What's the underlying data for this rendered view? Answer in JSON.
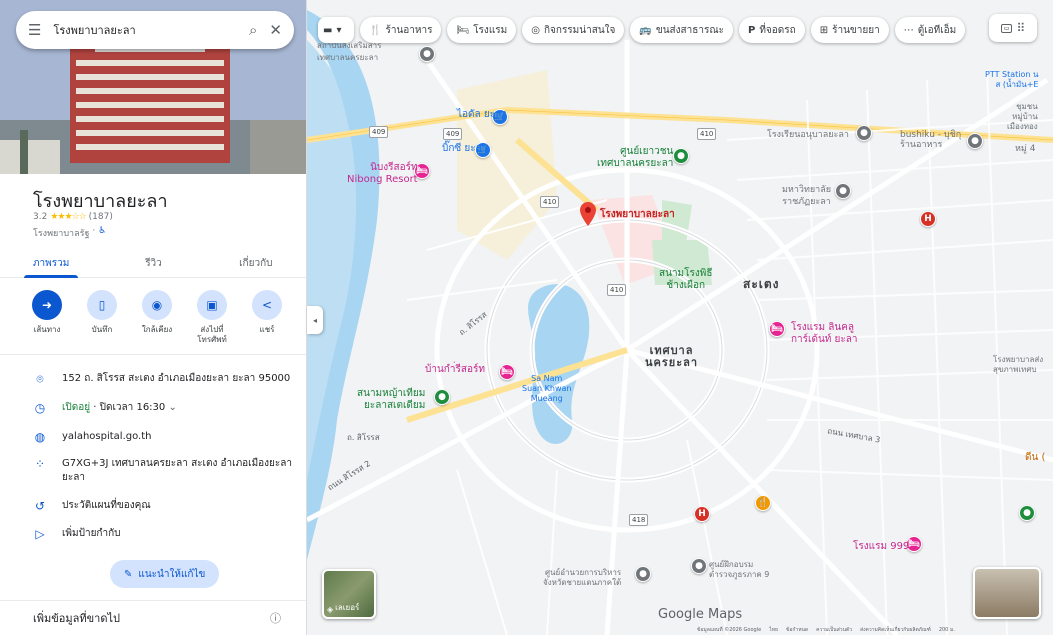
{
  "search": {
    "value": "โรงพยาบาลยะลา"
  },
  "place": {
    "name": "โรงพยาบาลยะลา",
    "rating": "3.2",
    "stars": "★★★☆☆",
    "reviews": "(187)",
    "category": "โรงพยาบาลรัฐ",
    "accessibility_icon": "accessible-icon"
  },
  "tabs": [
    "ภาพรวม",
    "รีวิว",
    "เกี่ยวกับ"
  ],
  "actions": [
    {
      "label": "เส้นทาง",
      "icon": "directions-icon"
    },
    {
      "label": "บันทึก",
      "icon": "bookmark-icon"
    },
    {
      "label": "ใกล้เคียง",
      "icon": "nearby-icon"
    },
    {
      "label": "ส่งไปที่โทรศัพท์",
      "icon": "send-to-phone-icon"
    },
    {
      "label": "แชร์",
      "icon": "share-icon"
    }
  ],
  "info": {
    "address": "152 ถ. สิโรรส สะเตง อำเภอเมืองยะลา ยะลา 95000",
    "hours_open": "เปิดอยู่",
    "hours_close": " · ปิดเวลา 16:30",
    "website": "yalahospital.go.th",
    "plus_code": "G7XG+3J เทศบาลนครยะลา สะเตง อำเภอเมืองยะลา ยะลา",
    "history": "ประวัติแผนที่ของคุณ",
    "label": "เพิ่มป้ายกำกับ"
  },
  "suggest_edit": "แนะนำให้แก้ไข",
  "add_missing": "เพิ่มข้อมูลที่ขาดไป",
  "chips": [
    {
      "icon": "restaurant-icon",
      "glyph": "🍴",
      "label": "ร้านอาหาร"
    },
    {
      "icon": "hotel-icon",
      "glyph": "🛏",
      "label": "โรงแรม"
    },
    {
      "icon": "camera-icon",
      "glyph": "◎",
      "label": "กิจกรรมน่าสนใจ"
    },
    {
      "icon": "transit-icon",
      "glyph": "🚌",
      "label": "ขนส่งสาธารณะ"
    },
    {
      "icon": "parking-icon",
      "glyph": "P",
      "label": "ที่จอดรถ"
    },
    {
      "icon": "pharmacy-icon",
      "glyph": "⊞",
      "label": "ร้านขายยา"
    },
    {
      "icon": "more-icon",
      "glyph": "⋯",
      "label": "ตู้เอทีเอ็ม"
    }
  ],
  "map": {
    "labels": [
      {
        "text": "สถาบันส่งเสริมสาร\nเทศบาลนครยะลา",
        "cls": "gray"
      },
      {
        "text": "ไอดัล ยะลา",
        "cls": "blue"
      },
      {
        "text": "บิ๊กซี ยะลา",
        "cls": "blue"
      },
      {
        "text": "นิบงรีสอร์ท\nNibong Resort",
        "cls": "pink"
      },
      {
        "text": "ศูนย์เยาวชน\nเทศบาลนครยะลา",
        "cls": "green"
      },
      {
        "text": "โรงพยาบาลยะลา",
        "cls": "red"
      },
      {
        "text": "สนามโรงพิธี\nช้างเผือก",
        "cls": "green"
      },
      {
        "text": "สะเตง",
        "cls": "dark"
      },
      {
        "text": "เทศบาล\nนครยะลา",
        "cls": "dark2"
      },
      {
        "text": "โรงแรม ลินคลู\nการ์เด้นท์ ยะลา",
        "cls": "pink"
      },
      {
        "text": "บ้านกำ่รีสอร์ท",
        "cls": "pink"
      },
      {
        "text": "สนามหญ้าเทียม\nยะลาสเตเดียม",
        "cls": "green"
      },
      {
        "text": "Sa Nam\nSuan Khwan\nMueang",
        "cls": "blue"
      },
      {
        "text": "โรงเรียนอนุบาลยะลา",
        "cls": "gray"
      },
      {
        "text": "มหาวิทยาลัย\nราชภัฏยะลา",
        "cls": "gray"
      },
      {
        "text": "bushiku - บุชิกุ\nร้านอาหาร",
        "cls": "gray"
      },
      {
        "text": "PTT Station น\nส (น้ำมัน+E",
        "cls": "blue"
      },
      {
        "text": "ชุมชน\nหมู่บ้าน\nเมืองทอง",
        "cls": "gray"
      },
      {
        "text": "หมู่ 4",
        "cls": "gray"
      },
      {
        "text": "โรงพยาบาลส่ง\nสุขภาพเทศบ",
        "cls": "gray"
      },
      {
        "text": "โรงแรม 999",
        "cls": "pink"
      },
      {
        "text": "ศูนย์อำนวยการบริหาร\nจังหวัดชายแดนภาคใต้",
        "cls": "gray"
      },
      {
        "text": "ศูนย์ฝึกอบรม\nตำรวจภูธรภาค 9",
        "cls": "gray"
      },
      {
        "text": "ดีน (",
        "cls": "orange"
      }
    ],
    "roads": [
      "ถ. สิโรรส",
      "ถ. สิโรรส",
      "ถนน สิโรรส 2",
      "ถนน เทศบาล 3"
    ],
    "shields": [
      "409",
      "409",
      "410",
      "410",
      "410",
      "418"
    ],
    "layers_label": "เลเยอร์",
    "google_logo": "Google Maps",
    "attribution": [
      "ข้อมูลแผนที่ ©2026 Google",
      "ไทย",
      "ข้อกำหนด",
      "ความเป็นส่วนตัว",
      "ส่งความคิดเห็นเกี่ยวกับผลิตภัณฑ์",
      "200 ม."
    ]
  },
  "colors": {
    "accent": "#0b57d0",
    "pin_red": "#ea4335",
    "open_green": "#188038",
    "water": "#a8d5f2",
    "park": "#c8e6c9"
  }
}
